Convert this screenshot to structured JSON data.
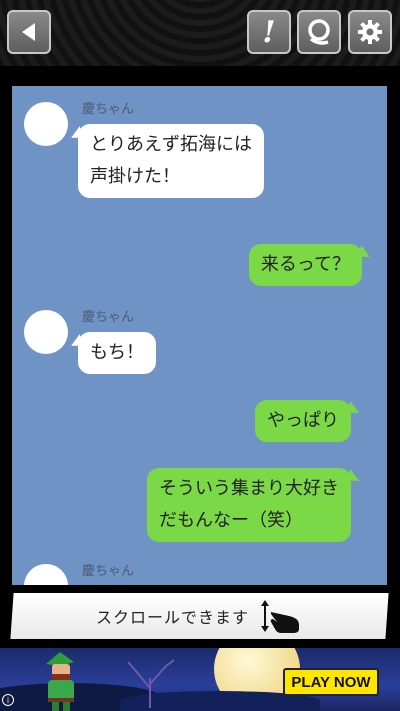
{
  "topbar": {
    "back_icon": "back-arrow-icon",
    "alert_label": "!",
    "quiz_icon": "q-icon",
    "settings_icon": "gear-icon",
    "button_color": "#6e6e6e"
  },
  "chat": {
    "background": "#7093c5",
    "messages": [
      {
        "side": "left",
        "sender": "慶ちゃん",
        "lines": [
          "とりあえず拓海には",
          "声掛けた！"
        ]
      },
      {
        "side": "right",
        "lines": [
          "来るって？"
        ]
      },
      {
        "side": "left",
        "sender": "慶ちゃん",
        "lines": [
          "もち！"
        ]
      },
      {
        "side": "right",
        "lines": [
          "やっぱり"
        ]
      },
      {
        "side": "right",
        "lines": [
          "そういう集まり大好き",
          "だもんなー（笑）"
        ]
      },
      {
        "side": "left",
        "sender": "慶ちゃん",
        "lines": []
      }
    ]
  },
  "scroll_hint": {
    "label": "スクロールできます",
    "icon": "swipe-hand-icon"
  },
  "ad": {
    "cta": "PLAY NOW",
    "info_icon": "info-icon"
  },
  "colors": {
    "incoming_bubble": "#ffffff",
    "outgoing_bubble": "#7bd947",
    "cta": "#ffe600"
  }
}
